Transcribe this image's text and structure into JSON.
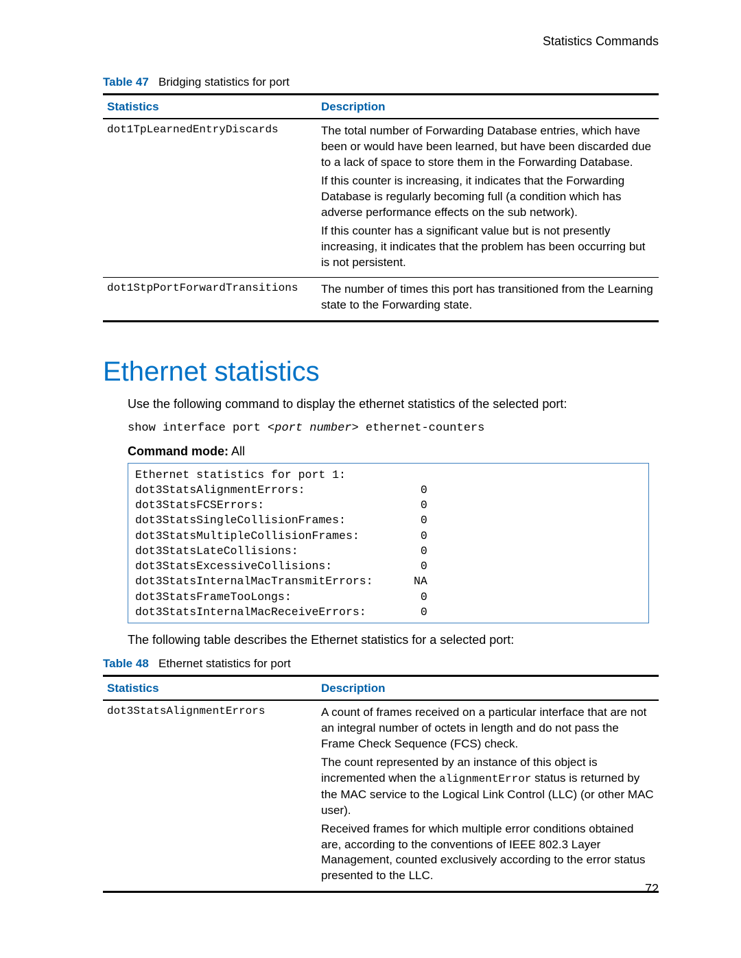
{
  "running_head": "Statistics Commands",
  "page_number": "72",
  "table47": {
    "caption_label": "Table 47",
    "caption_text": "Bridging statistics for port",
    "col_stat": "Statistics",
    "col_desc": "Description",
    "rows": [
      {
        "stat": "dot1TpLearnedEntryDiscards",
        "desc": [
          "The total number of Forwarding Database entries, which have been or would have been learned, but have been discarded due to a lack of space to store them in the Forwarding Database.",
          "If this counter is increasing, it indicates that the Forwarding Database is regularly becoming full (a condition which has adverse performance effects on the sub network).",
          "If this counter has a significant value but is not presently increasing, it indicates that the problem has been occurring but is not persistent."
        ]
      },
      {
        "stat": "dot1StpPortForwardTransitions",
        "desc": [
          "The number of times this port has transitioned from the Learning state to the Forwarding state."
        ]
      }
    ]
  },
  "ethernet": {
    "heading": "Ethernet statistics",
    "intro": "Use the following command to display the ethernet statistics of the selected port:",
    "cmd_prefix": "show interface port <",
    "cmd_arg": "port number",
    "cmd_suffix": "> ethernet-counters",
    "mode_label": "Command mode:",
    "mode_value": " All",
    "output": "Ethernet statistics for port 1:\ndot3StatsAlignmentErrors:                 0\ndot3StatsFCSErrors:                       0\ndot3StatsSingleCollisionFrames:           0\ndot3StatsMultipleCollisionFrames:         0\ndot3StatsLateCollisions:                  0\ndot3StatsExcessiveCollisions:             0\ndot3StatsInternalMacTransmitErrors:      NA\ndot3StatsFrameTooLongs:                   0\ndot3StatsInternalMacReceiveErrors:        0",
    "after_box": "The following table describes the Ethernet statistics for a selected port:"
  },
  "table48": {
    "caption_label": "Table 48",
    "caption_text": "Ethernet statistics for port",
    "col_stat": "Statistics",
    "col_desc": "Description",
    "row": {
      "stat": "dot3StatsAlignmentErrors",
      "desc_p1": "A count of frames received on a particular interface that are not an integral number of octets in length and do not pass the Frame Check Sequence (FCS) check.",
      "desc_p2_a": "The count represented by an instance of this object is incremented when the ",
      "desc_p2_code": "alignmentError",
      "desc_p2_b": " status is returned by the MAC service to the Logical Link Control (LLC) (or other MAC user).",
      "desc_p3": "Received frames for which multiple error conditions obtained are, according to the conventions of IEEE 802.3 Layer Management, counted exclusively according to the error status presented to the LLC."
    }
  }
}
